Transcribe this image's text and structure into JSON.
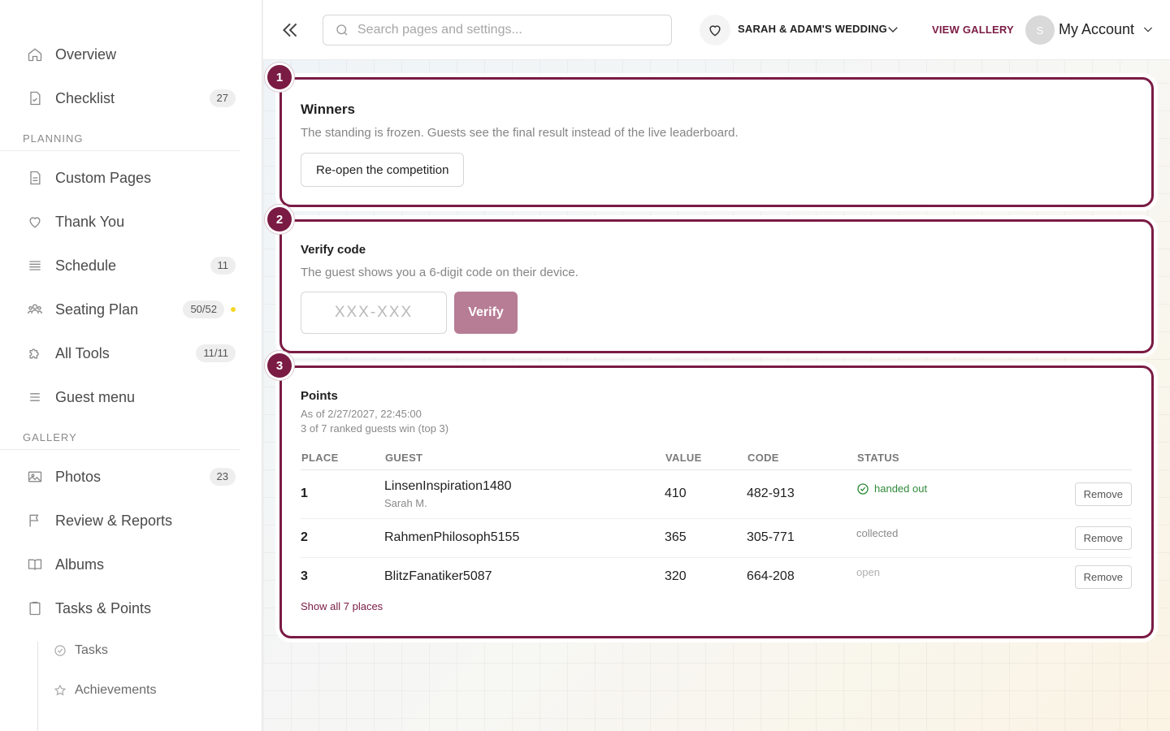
{
  "sidebar": {
    "items": [
      {
        "label": "Overview",
        "icon": "home-icon"
      },
      {
        "label": "Checklist",
        "badge": "27",
        "icon": "checklist-icon"
      }
    ],
    "planning_label": "PLANNING",
    "planning": [
      {
        "label": "Custom Pages",
        "icon": "page-icon"
      },
      {
        "label": "Thank You",
        "icon": "heart-icon"
      },
      {
        "label": "Schedule",
        "badge": "11",
        "icon": "schedule-icon"
      },
      {
        "label": "Seating Plan",
        "badge": "50/52",
        "icon": "people-icon",
        "dot_color": "#f5d728"
      },
      {
        "label": "All Tools",
        "badge": "11/11",
        "icon": "puzzle-icon"
      },
      {
        "label": "Guest menu",
        "icon": "menu-icon"
      }
    ],
    "gallery_label": "GALLERY",
    "gallery": [
      {
        "label": "Photos",
        "badge": "23",
        "icon": "image-icon"
      },
      {
        "label": "Review & Reports",
        "icon": "flag-icon"
      },
      {
        "label": "Albums",
        "icon": "book-icon"
      },
      {
        "label": "Tasks & Points",
        "icon": "clipboard-icon"
      }
    ],
    "sub_items": [
      {
        "label": "Tasks",
        "icon": "check-circle-icon"
      },
      {
        "label": "Achievements",
        "icon": "star-icon"
      }
    ]
  },
  "topbar": {
    "search_placeholder": "Search pages and settings...",
    "event_name": "SARAH & ADAM'S WEDDING",
    "view_gallery": "VIEW GALLERY",
    "avatar_initial": "S",
    "account_label": "My Account"
  },
  "winners": {
    "step": "1",
    "title": "Winners",
    "description": "The standing is frozen. Guests see the final result instead of the live leaderboard.",
    "reopen_label": "Re-open the competition"
  },
  "verify": {
    "step": "2",
    "title": "Verify code",
    "description": "The guest shows you a 6-digit code on their device.",
    "code_placeholder": "XXX-XXX",
    "verify_label": "Verify"
  },
  "points": {
    "step": "3",
    "title": "Points",
    "as_of": "As of 2/27/2027, 22:45:00",
    "winners_note": "3 of 7 ranked guests win (top 3)",
    "columns": [
      "PLACE",
      "GUEST",
      "VALUE",
      "CODE",
      "STATUS"
    ],
    "rows": [
      {
        "place": "1",
        "guest": "LinsenInspiration1480",
        "guest_sub": "Sarah M.",
        "value": "410",
        "code": "482-913",
        "status": "handed out",
        "remove": "Remove"
      },
      {
        "place": "2",
        "guest": "RahmenPhilosoph5155",
        "guest_sub": "",
        "value": "365",
        "code": "305-771",
        "status": "collected",
        "remove": "Remove"
      },
      {
        "place": "3",
        "guest": "BlitzFanatiker5087",
        "guest_sub": "",
        "value": "320",
        "code": "664-208",
        "status": "open",
        "remove": "Remove"
      }
    ],
    "show_all": "Show all 7 places"
  },
  "colors": {
    "accent": "#7a1b44",
    "verify_button": "#b77d95",
    "status_handed": "#2f8a3a"
  }
}
